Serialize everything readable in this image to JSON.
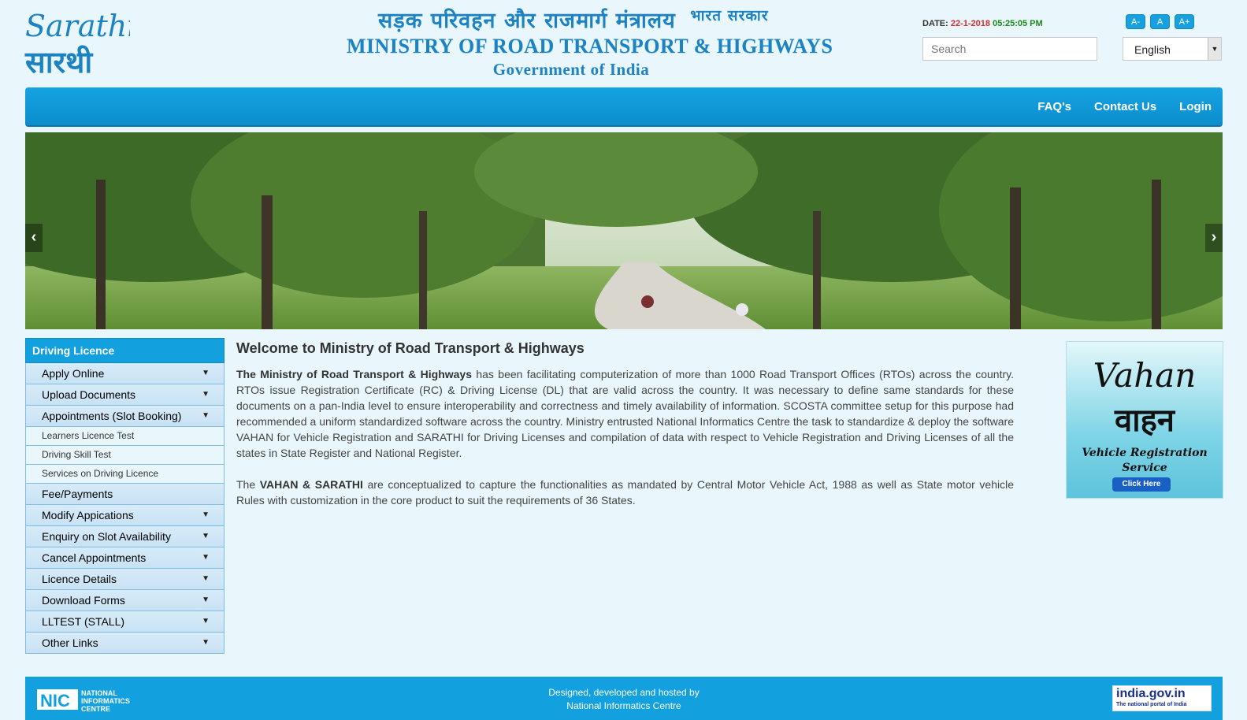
{
  "header": {
    "logo_en": "Sarathi",
    "logo_hi": "सारथी",
    "ministry_hindi": "सड़क परिवहन और राजमार्ग मंत्रालय",
    "ministry_hindi_small": "भारत सरकार",
    "ministry_en": "MINISTRY OF ROAD TRANSPORT & HIGHWAYS",
    "gov_india": "Government of India",
    "date_label": "DATE: ",
    "date_value": "22-1-2018",
    "time_value": "05:25:05 PM",
    "font_decrease": "A-",
    "font_normal": "A",
    "font_increase": "A+",
    "search_placeholder": "Search",
    "language": "English"
  },
  "navbar": {
    "items": [
      {
        "label": "FAQ's"
      },
      {
        "label": "Contact Us"
      },
      {
        "label": "Login"
      }
    ]
  },
  "sidebar": {
    "title": "Driving Licence",
    "items": [
      {
        "label": "Apply Online"
      },
      {
        "label": "Upload Documents"
      },
      {
        "label": "Appointments (Slot Booking)"
      },
      {
        "label": "Learners Licence Test"
      },
      {
        "label": "Driving Skill Test"
      },
      {
        "label": "Services on Driving Licence"
      },
      {
        "label": "Fee/Payments"
      },
      {
        "label": "Modify Appications"
      },
      {
        "label": "Enquiry on Slot Availability"
      },
      {
        "label": "Cancel Appointments"
      },
      {
        "label": "Licence Details"
      },
      {
        "label": "Download Forms"
      },
      {
        "label": "LLTEST (STALL)"
      },
      {
        "label": "Other Links"
      }
    ]
  },
  "content": {
    "heading": "Welcome to Ministry of Road Transport & Highways",
    "p1_bold": "The Ministry of Road Transport & Highways",
    "p1_rest": " has been facilitating computerization of more than 1000 Road Transport Offices (RTOs) across the country. RTOs issue Registration Certificate (RC) & Driving License (DL) that are valid across the country. It was necessary to define same standards for these documents on a pan-India level to ensure interoperability and correctness and timely availability of information. SCOSTA committee setup for this purpose had recommended a uniform standardized software across the country. Ministry entrusted National Informatics Centre the task to standardize & deploy the software VAHAN for Vehicle Registration and SARATHI for Driving Licenses and compilation of data with respect to Vehicle Registration and Driving Licenses of all the states in State Register and National Register.",
    "p2_start": "The ",
    "p2_bold": "VAHAN & SARATHI",
    "p2_rest": " are conceptualized to capture the functionalities as mandated by Central Motor Vehicle Act, 1988 as well as State motor vehicle Rules with customization in the core product to suit the requirements of 36 States."
  },
  "vahan_ad": {
    "title": "Vahan",
    "title_hi": "वाहन",
    "subtitle_1": "Vehicle Registration",
    "subtitle_2": "Service",
    "button": "Click Here"
  },
  "footer": {
    "nic_1": "NATIONAL",
    "nic_2": "INFORMATICS",
    "nic_3": "CENTRE",
    "designed_line1": "Designed, developed and hosted by",
    "designed_line2": "National Informatics Centre",
    "indiagov": "india.gov.in",
    "indiagov_sub": "The national portal of India"
  }
}
